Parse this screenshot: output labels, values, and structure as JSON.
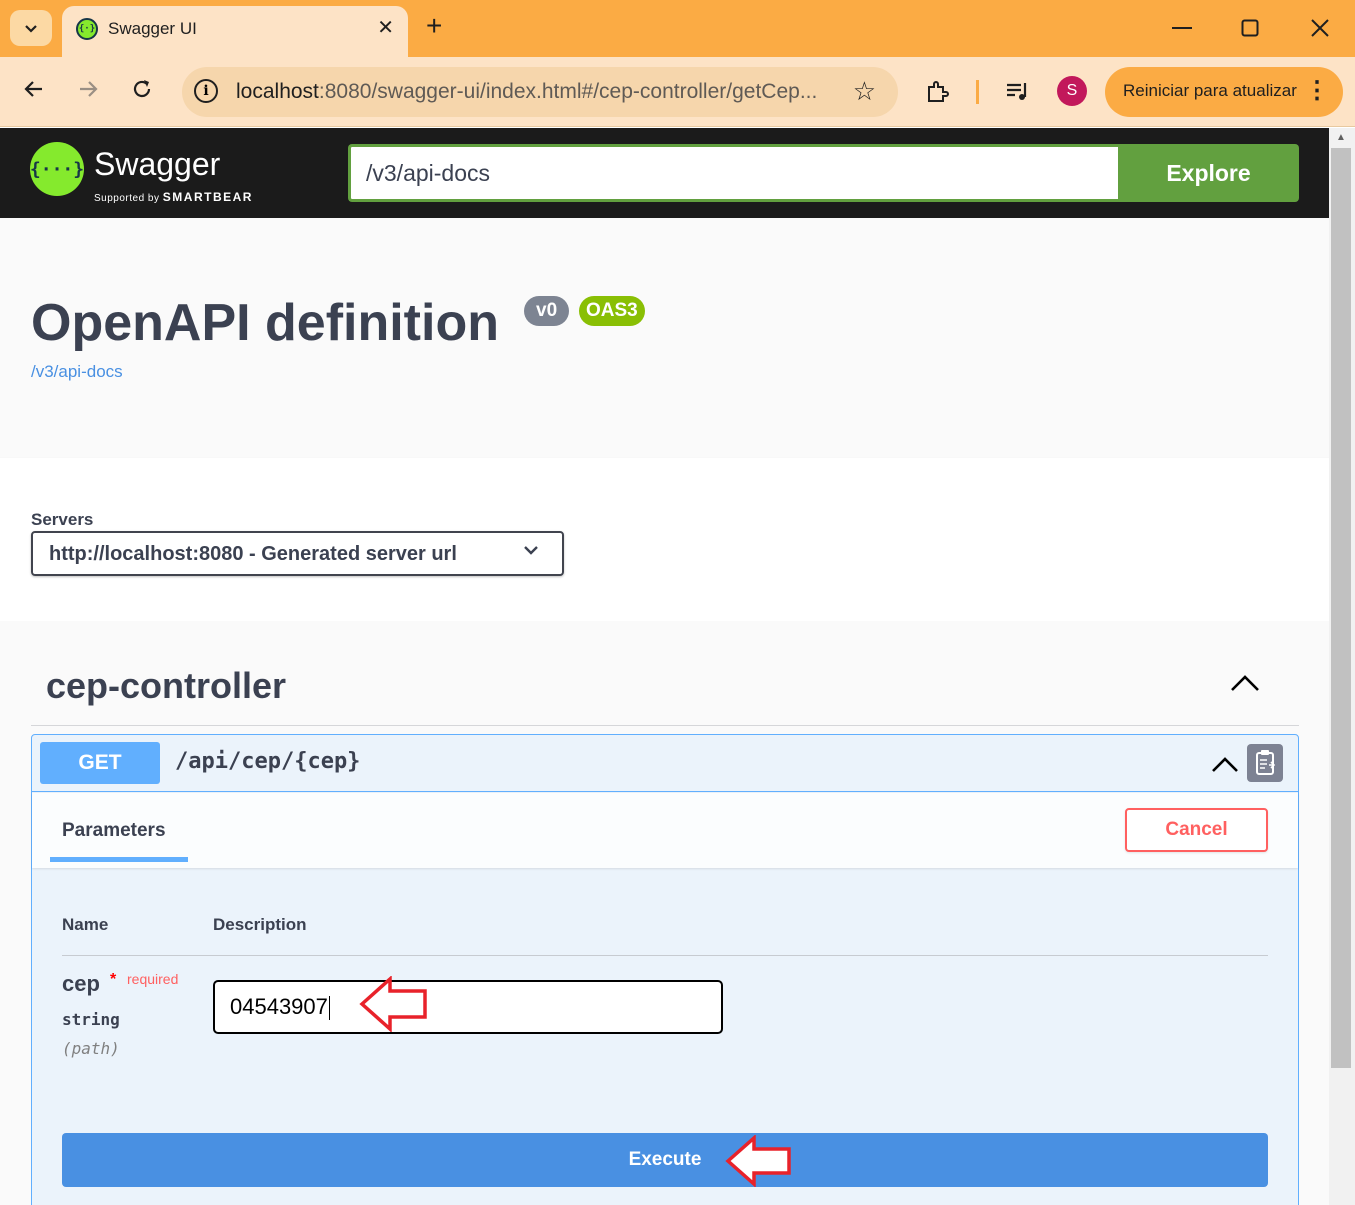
{
  "browser": {
    "tab_title": "Swagger UI",
    "url_host": "localhost",
    "url_rest": ":8080/swagger-ui/index.html#/cep-controller/getCep...",
    "profile_initial": "S",
    "update_label": "Reiniciar para atualizar"
  },
  "swagger": {
    "brand": "Swagger",
    "supported_by": "Supported by",
    "smartbear": "SMARTBEAR",
    "spec_url": "/v3/api-docs",
    "explore_label": "Explore"
  },
  "info": {
    "title": "OpenAPI definition",
    "version": "v0",
    "oas": "OAS3",
    "link": "/v3/api-docs"
  },
  "servers": {
    "label": "Servers",
    "selected": "http://localhost:8080 - Generated server url"
  },
  "tag": {
    "name": "cep-controller"
  },
  "operation": {
    "method": "GET",
    "path": "/api/cep/{cep}",
    "tab_label": "Parameters",
    "cancel_label": "Cancel",
    "columns": {
      "name": "Name",
      "description": "Description"
    },
    "param": {
      "name": "cep",
      "star": "*",
      "required_label": "required",
      "type": "string",
      "location": "(path)",
      "value": "04543907"
    },
    "execute_label": "Execute"
  },
  "colors": {
    "get": "#61affe",
    "swagger_green": "#85ea2d",
    "explore_green": "#62a03f",
    "annotation_red": "#e8222a",
    "chrome_orange": "#fbab44"
  }
}
